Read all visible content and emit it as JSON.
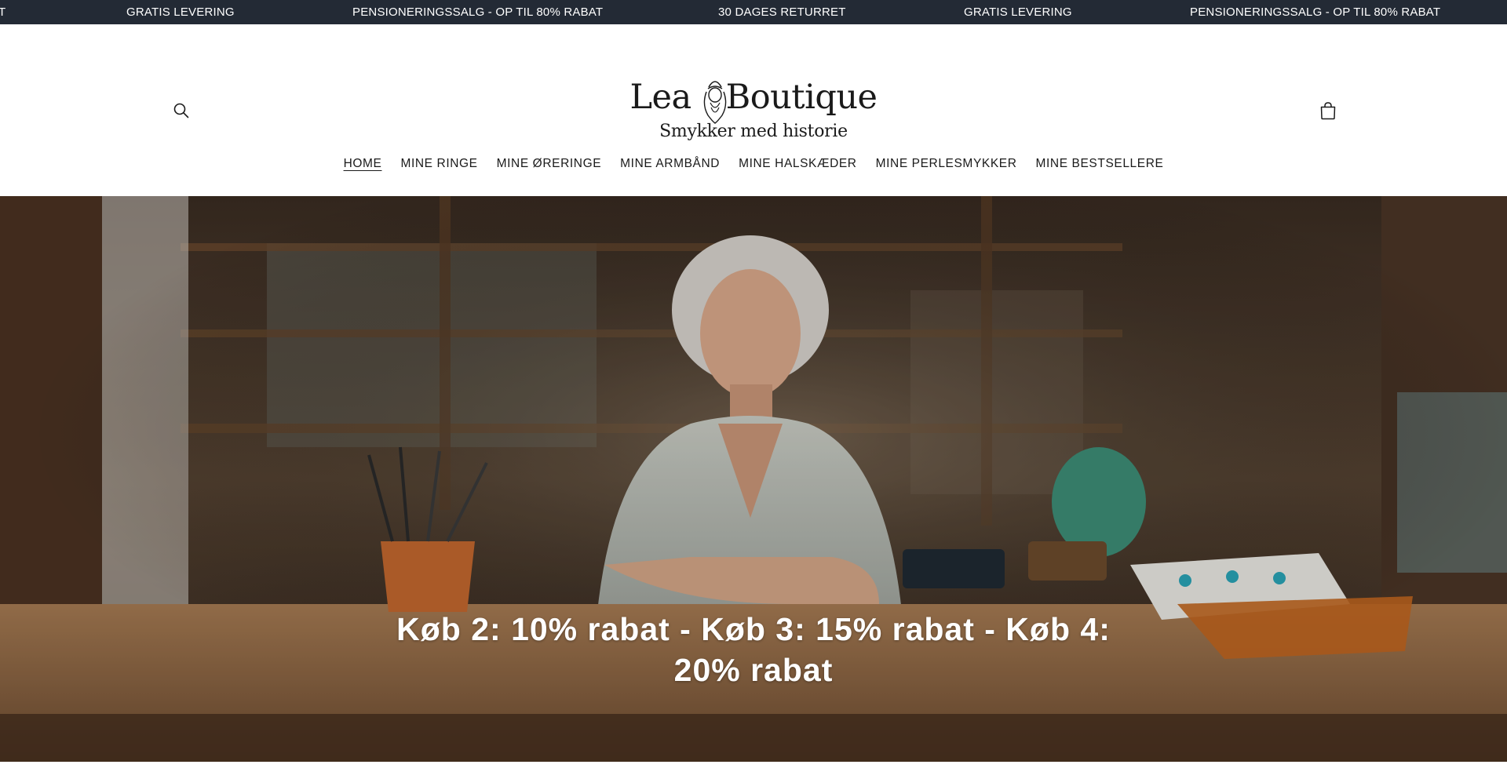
{
  "announcement_bar": {
    "items": [
      "T",
      "GRATIS LEVERING",
      "PENSIONERINGSSALG - OP TIL 80% RABAT",
      "30 DAGES RETURRET",
      "GRATIS LEVERING",
      "PENSIONERINGSSALG - OP TIL 80% RABAT"
    ]
  },
  "header": {
    "logo": {
      "name_left": "Lea",
      "name_right": "Boutique",
      "tagline": "Smykker med historie"
    },
    "icons": {
      "search": "search-icon",
      "cart": "cart-icon"
    }
  },
  "nav": {
    "items": [
      {
        "label": "HOME",
        "active": true
      },
      {
        "label": "MINE RINGE",
        "active": false
      },
      {
        "label": "MINE ØRERINGE",
        "active": false
      },
      {
        "label": "MINE ARMBÅND",
        "active": false
      },
      {
        "label": "MINE HALSKÆDER",
        "active": false
      },
      {
        "label": "MINE PERLESMYKKER",
        "active": false
      },
      {
        "label": "MINE BESTSELLERE",
        "active": false
      }
    ]
  },
  "hero": {
    "heading_line1": "Køb 2: 10% rabat - Køb 3: 15% rabat - Køb 4:",
    "heading_line2": "20% rabat"
  },
  "colors": {
    "announcement_bg": "#232a35",
    "announcement_text": "#ffffff",
    "header_bg": "#ffffff",
    "text": "#121212"
  }
}
